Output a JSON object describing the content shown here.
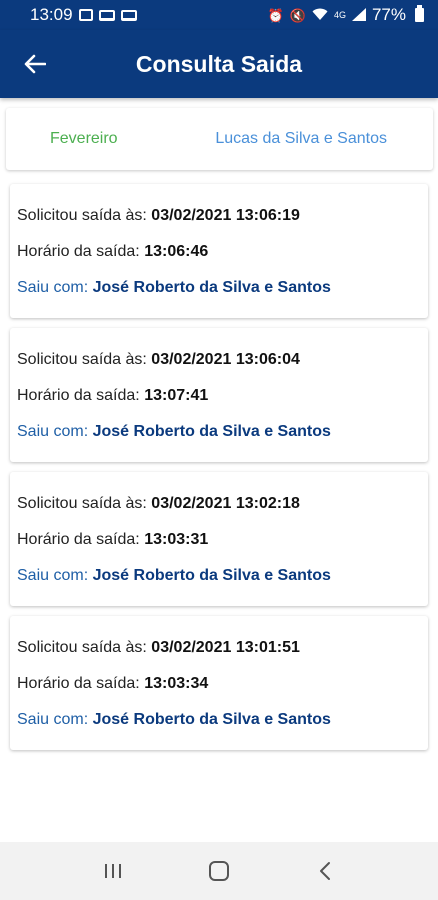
{
  "status_bar": {
    "time": "13:09",
    "battery": "77%",
    "network": "4G"
  },
  "app_bar": {
    "title": "Consulta Saida",
    "back_icon": "arrow-left-icon"
  },
  "filter": {
    "month": "Fevereiro",
    "person": "Lucas da Silva e Santos",
    "month_color": "#4caf50",
    "person_color": "#4a90d9"
  },
  "labels": {
    "requested": "Solicitou saída às:",
    "exit_time": "Horário da saída:",
    "left_with": "Saiu com:"
  },
  "records": [
    {
      "requested": "03/02/2021 13:06:19",
      "exit_time": "13:06:46",
      "left_with": "José Roberto da Silva e Santos"
    },
    {
      "requested": "03/02/2021 13:06:04",
      "exit_time": "13:07:41",
      "left_with": "José Roberto da Silva e Santos"
    },
    {
      "requested": "03/02/2021 13:02:18",
      "exit_time": "13:03:31",
      "left_with": "José Roberto da Silva e Santos"
    },
    {
      "requested": "03/02/2021 13:01:51",
      "exit_time": "13:03:34",
      "left_with": "José Roberto da Silva e Santos"
    }
  ],
  "nav_bar": {
    "recents_icon": "recents-icon",
    "home_icon": "home-icon",
    "back_icon": "back-chevron-icon"
  },
  "colors": {
    "primary": "#0b3a7e",
    "link": "#1f5fa6"
  }
}
